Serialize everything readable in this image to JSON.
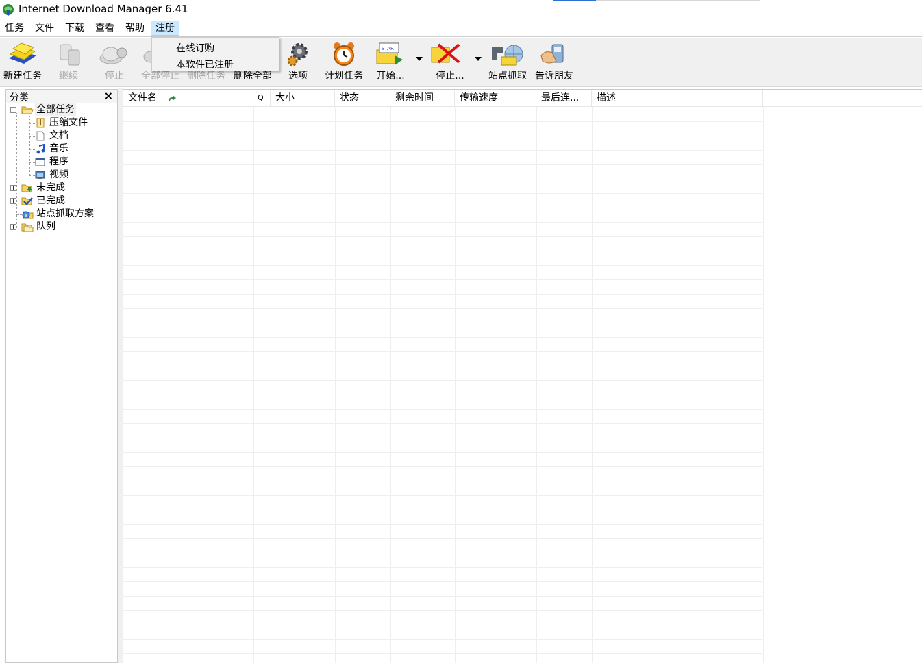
{
  "window": {
    "title": "Internet Download Manager 6.41"
  },
  "menubar": {
    "items": [
      {
        "label": "任务"
      },
      {
        "label": "文件"
      },
      {
        "label": "下载"
      },
      {
        "label": "查看"
      },
      {
        "label": "帮助"
      },
      {
        "label": "注册"
      }
    ]
  },
  "dropdown": {
    "items": [
      {
        "label": "在线订购"
      },
      {
        "label": "本软件已注册"
      }
    ]
  },
  "toolbar": {
    "buttons": [
      {
        "label": "新建任务",
        "icon": "new-task-icon"
      },
      {
        "label": "继续",
        "icon": "resume-icon"
      },
      {
        "label": "停止",
        "icon": "stop-icon"
      },
      {
        "label": "全部停止",
        "icon": "stop-all-icon"
      },
      {
        "label": "删除任务",
        "icon": "delete-task-icon"
      },
      {
        "label": "删除全部",
        "icon": "delete-all-icon"
      },
      {
        "label": "选项",
        "icon": "options-gear-icon"
      },
      {
        "label": "计划任务",
        "icon": "scheduler-clock-icon"
      },
      {
        "label": "开始...",
        "icon": "start-queue-icon"
      },
      {
        "label": "停止...",
        "icon": "stop-queue-icon"
      },
      {
        "label": "站点抓取",
        "icon": "site-grabber-icon"
      },
      {
        "label": "告诉朋友",
        "icon": "tell-friend-icon"
      }
    ]
  },
  "sidebar": {
    "title": "分类",
    "close": "×",
    "tree": [
      {
        "label": "全部任务",
        "icon": "open-folder-icon"
      },
      {
        "label": "压缩文件",
        "icon": "archive-icon"
      },
      {
        "label": "文档",
        "icon": "document-icon"
      },
      {
        "label": "音乐",
        "icon": "music-icon"
      },
      {
        "label": "程序",
        "icon": "program-icon"
      },
      {
        "label": "视频",
        "icon": "video-icon"
      },
      {
        "label": "未完成",
        "icon": "unfinished-folder-icon"
      },
      {
        "label": "已完成",
        "icon": "finished-folder-icon"
      },
      {
        "label": "站点抓取方案",
        "icon": "grabber-project-icon"
      },
      {
        "label": "队列",
        "icon": "queue-folder-icon"
      }
    ]
  },
  "list": {
    "columns": [
      {
        "label": "文件名"
      },
      {
        "label": "Q"
      },
      {
        "label": "大小"
      },
      {
        "label": "状态"
      },
      {
        "label": "剩余时间"
      },
      {
        "label": "传输速度"
      },
      {
        "label": "最后连..."
      },
      {
        "label": "描述"
      }
    ],
    "sort_icon": "sort-ascending-arrow-icon"
  },
  "colors": {
    "menu_active": "#cce8ff",
    "toolbar_bg": "#f0f0f0"
  }
}
